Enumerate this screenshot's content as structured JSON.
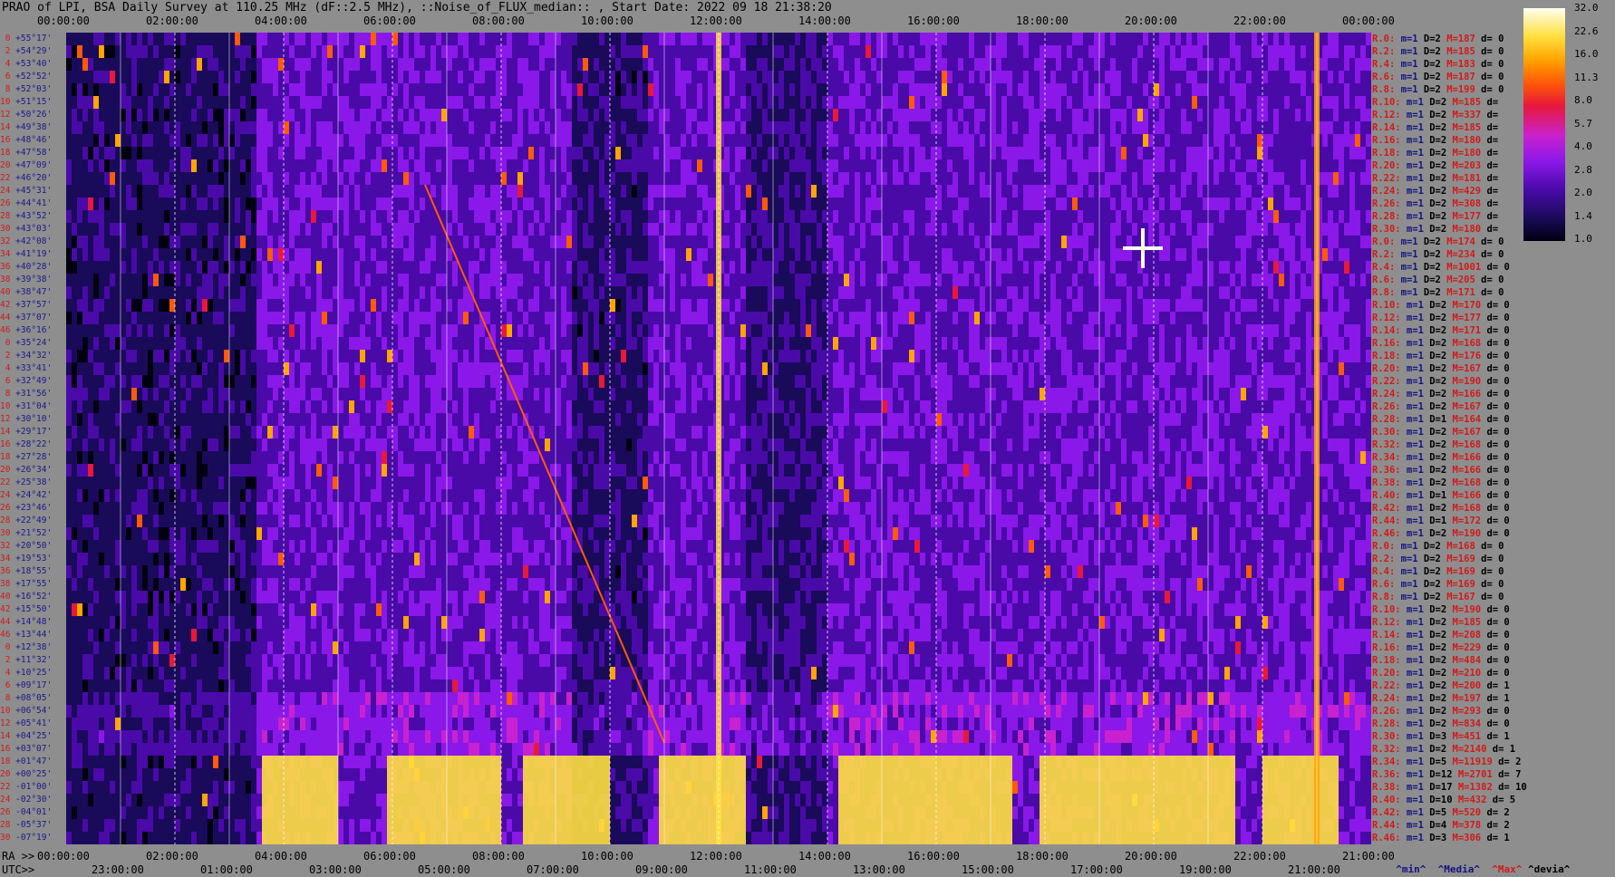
{
  "title": "PRAO of LPI, BSA Daily Survey at 110.25 MHz (dF::2.5 MHz), ::Noise_of_FLUX_median:: , Start Date: 2022 09 18 21:38:20",
  "top_axis_labels": [
    "00:00:00",
    "02:00:00",
    "04:00:00",
    "06:00:00",
    "08:00:00",
    "10:00:00",
    "12:00:00",
    "14:00:00",
    "16:00:00",
    "18:00:00",
    "20:00:00",
    "22:00:00",
    "00:00:00"
  ],
  "ra_prefix": "RA >>",
  "bottom_ra_labels": [
    "00:00:00",
    "02:00:00",
    "04:00:00",
    "06:00:00",
    "08:00:00",
    "10:00:00",
    "12:00:00",
    "14:00:00",
    "16:00:00",
    "18:00:00",
    "20:00:00",
    "22:00:00",
    "21:00:00"
  ],
  "utc_prefix": "UTC>>",
  "bottom_utc_labels": [
    "23:00:00",
    "01:00:00",
    "03:00:00",
    "05:00:00",
    "07:00:00",
    "09:00:00",
    "11:00:00",
    "13:00:00",
    "15:00:00",
    "17:00:00",
    "19:00:00",
    "21:00:00"
  ],
  "colorbar_labels": [
    "32.0",
    "22.6",
    "16.0",
    "11.3",
    "8.0",
    "5.7",
    "4.0",
    "2.8",
    "2.0",
    "1.4",
    "1.0"
  ],
  "legend": {
    "min": "^min^",
    "median": "^Media^",
    "max": "^Max^",
    "devia": "^devia^"
  },
  "declinations": [
    {
      "i": "0",
      "d": "+55°17'"
    },
    {
      "i": "2",
      "d": "+54°29'"
    },
    {
      "i": "4",
      "d": "+53°40'"
    },
    {
      "i": "6",
      "d": "+52°52'"
    },
    {
      "i": "8",
      "d": "+52°03'"
    },
    {
      "i": "10",
      "d": "+51°15'"
    },
    {
      "i": "12",
      "d": "+50°26'"
    },
    {
      "i": "14",
      "d": "+49°38'"
    },
    {
      "i": "16",
      "d": "+48°46'"
    },
    {
      "i": "18",
      "d": "+47°58'"
    },
    {
      "i": "20",
      "d": "+47°09'"
    },
    {
      "i": "22",
      "d": "+46°20'"
    },
    {
      "i": "24",
      "d": "+45°31'"
    },
    {
      "i": "26",
      "d": "+44°41'"
    },
    {
      "i": "28",
      "d": "+43°52'"
    },
    {
      "i": "30",
      "d": "+43°03'"
    },
    {
      "i": "32",
      "d": "+42°08'"
    },
    {
      "i": "34",
      "d": "+41°19'"
    },
    {
      "i": "36",
      "d": "+40°28'"
    },
    {
      "i": "38",
      "d": "+39°38'"
    },
    {
      "i": "40",
      "d": "+38°47'"
    },
    {
      "i": "42",
      "d": "+37°57'"
    },
    {
      "i": "44",
      "d": "+37°07'"
    },
    {
      "i": "46",
      "d": "+36°16'"
    },
    {
      "i": "0",
      "d": "+35°24'"
    },
    {
      "i": "2",
      "d": "+34°32'"
    },
    {
      "i": "4",
      "d": "+33°41'"
    },
    {
      "i": "6",
      "d": "+32°49'"
    },
    {
      "i": "8",
      "d": "+31°56'"
    },
    {
      "i": "10",
      "d": "+31°04'"
    },
    {
      "i": "12",
      "d": "+30°10'"
    },
    {
      "i": "14",
      "d": "+29°17'"
    },
    {
      "i": "16",
      "d": "+28°22'"
    },
    {
      "i": "18",
      "d": "+27°28'"
    },
    {
      "i": "20",
      "d": "+26°34'"
    },
    {
      "i": "22",
      "d": "+25°38'"
    },
    {
      "i": "24",
      "d": "+24°42'"
    },
    {
      "i": "26",
      "d": "+23°46'"
    },
    {
      "i": "28",
      "d": "+22°49'"
    },
    {
      "i": "30",
      "d": "+21°52'"
    },
    {
      "i": "32",
      "d": "+20°50'"
    },
    {
      "i": "34",
      "d": "+19°53'"
    },
    {
      "i": "36",
      "d": "+18°55'"
    },
    {
      "i": "38",
      "d": "+17°55'"
    },
    {
      "i": "40",
      "d": "+16°52'"
    },
    {
      "i": "42",
      "d": "+15°50'"
    },
    {
      "i": "44",
      "d": "+14°48'"
    },
    {
      "i": "46",
      "d": "+13°44'"
    },
    {
      "i": "0",
      "d": "+12°38'"
    },
    {
      "i": "2",
      "d": "+11°32'"
    },
    {
      "i": "4",
      "d": "+10°25'"
    },
    {
      "i": "6",
      "d": "+09°17'"
    },
    {
      "i": "8",
      "d": "+08°05'"
    },
    {
      "i": "10",
      "d": "+06°54'"
    },
    {
      "i": "12",
      "d": "+05°41'"
    },
    {
      "i": "14",
      "d": "+04°25'"
    },
    {
      "i": "16",
      "d": "+03°07'"
    },
    {
      "i": "18",
      "d": "+01°47'"
    },
    {
      "i": "20",
      "d": "+00°25'"
    },
    {
      "i": "22",
      "d": "-01°00'"
    },
    {
      "i": "24",
      "d": "-02°30'"
    },
    {
      "i": "26",
      "d": "-04°01'"
    },
    {
      "i": "28",
      "d": "-05°37'"
    },
    {
      "i": "30",
      "d": "-07°19'"
    }
  ],
  "stats": [
    {
      "r": "R.0:",
      "m": "m=1",
      "D": "D=2",
      "M": "M=187",
      "dv": "d= 0"
    },
    {
      "r": "R.2:",
      "m": "m=1",
      "D": "D=2",
      "M": "M=185",
      "dv": "d= 0"
    },
    {
      "r": "R.4:",
      "m": "m=1",
      "D": "D=2",
      "M": "M=183",
      "dv": "d= 0"
    },
    {
      "r": "R.6:",
      "m": "m=1",
      "D": "D=2",
      "M": "M=187",
      "dv": "d= 0"
    },
    {
      "r": "R.8:",
      "m": "m=1",
      "D": "D=2",
      "M": "M=199",
      "dv": "d= 0"
    },
    {
      "r": "R.10:",
      "m": "m=1",
      "D": "D=2",
      "M": "M=185",
      "dv": "d="
    },
    {
      "r": "R.12:",
      "m": "m=1",
      "D": "D=2",
      "M": "M=337",
      "dv": "d="
    },
    {
      "r": "R.14:",
      "m": "m=1",
      "D": "D=2",
      "M": "M=185",
      "dv": "d="
    },
    {
      "r": "R.16:",
      "m": "m=1",
      "D": "D=2",
      "M": "M=180",
      "dv": "d="
    },
    {
      "r": "R.18:",
      "m": "m=1",
      "D": "D=2",
      "M": "M=180",
      "dv": "d="
    },
    {
      "r": "R.20:",
      "m": "m=1",
      "D": "D=2",
      "M": "M=203",
      "dv": "d="
    },
    {
      "r": "R.22:",
      "m": "m=1",
      "D": "D=2",
      "M": "M=181",
      "dv": "d="
    },
    {
      "r": "R.24:",
      "m": "m=1",
      "D": "D=2",
      "M": "M=429",
      "dv": "d="
    },
    {
      "r": "R.26:",
      "m": "m=1",
      "D": "D=2",
      "M": "M=308",
      "dv": "d="
    },
    {
      "r": "R.28:",
      "m": "m=1",
      "D": "D=2",
      "M": "M=177",
      "dv": "d="
    },
    {
      "r": "R.30:",
      "m": "m=1",
      "D": "D=2",
      "M": "M=180",
      "dv": "d="
    },
    {
      "r": "R.0:",
      "m": "m=1",
      "D": "D=2",
      "M": "M=174",
      "dv": "d= 0"
    },
    {
      "r": "R.2:",
      "m": "m=1",
      "D": "D=2",
      "M": "M=234",
      "dv": "d= 0"
    },
    {
      "r": "R.4:",
      "m": "m=1",
      "D": "D=2",
      "M": "M=1001",
      "dv": "d= 0"
    },
    {
      "r": "R.6:",
      "m": "m=1",
      "D": "D=2",
      "M": "M=205",
      "dv": "d= 0"
    },
    {
      "r": "R.8:",
      "m": "m=1",
      "D": "D=2",
      "M": "M=171",
      "dv": "d= 0"
    },
    {
      "r": "R.10:",
      "m": "m=1",
      "D": "D=2",
      "M": "M=170",
      "dv": "d= 0"
    },
    {
      "r": "R.12:",
      "m": "m=1",
      "D": "D=2",
      "M": "M=177",
      "dv": "d= 0"
    },
    {
      "r": "R.14:",
      "m": "m=1",
      "D": "D=2",
      "M": "M=171",
      "dv": "d= 0"
    },
    {
      "r": "R.16:",
      "m": "m=1",
      "D": "D=2",
      "M": "M=168",
      "dv": "d= 0"
    },
    {
      "r": "R.18:",
      "m": "m=1",
      "D": "D=2",
      "M": "M=176",
      "dv": "d= 0"
    },
    {
      "r": "R.20:",
      "m": "m=1",
      "D": "D=2",
      "M": "M=167",
      "dv": "d= 0"
    },
    {
      "r": "R.22:",
      "m": "m=1",
      "D": "D=2",
      "M": "M=190",
      "dv": "d= 0"
    },
    {
      "r": "R.24:",
      "m": "m=1",
      "D": "D=2",
      "M": "M=166",
      "dv": "d= 0"
    },
    {
      "r": "R.26:",
      "m": "m=1",
      "D": "D=2",
      "M": "M=167",
      "dv": "d= 0"
    },
    {
      "r": "R.28:",
      "m": "m=1",
      "D": "D=1",
      "M": "M=164",
      "dv": "d= 0"
    },
    {
      "r": "R.30:",
      "m": "m=1",
      "D": "D=2",
      "M": "M=167",
      "dv": "d= 0"
    },
    {
      "r": "R.32:",
      "m": "m=1",
      "D": "D=2",
      "M": "M=168",
      "dv": "d= 0"
    },
    {
      "r": "R.34:",
      "m": "m=1",
      "D": "D=2",
      "M": "M=166",
      "dv": "d= 0"
    },
    {
      "r": "R.36:",
      "m": "m=1",
      "D": "D=2",
      "M": "M=166",
      "dv": "d= 0"
    },
    {
      "r": "R.38:",
      "m": "m=1",
      "D": "D=2",
      "M": "M=168",
      "dv": "d= 0"
    },
    {
      "r": "R.40:",
      "m": "m=1",
      "D": "D=1",
      "M": "M=166",
      "dv": "d= 0"
    },
    {
      "r": "R.42:",
      "m": "m=1",
      "D": "D=2",
      "M": "M=168",
      "dv": "d= 0"
    },
    {
      "r": "R.44:",
      "m": "m=1",
      "D": "D=1",
      "M": "M=172",
      "dv": "d= 0"
    },
    {
      "r": "R.46:",
      "m": "m=1",
      "D": "D=2",
      "M": "M=190",
      "dv": "d= 0"
    },
    {
      "r": "R.0:",
      "m": "m=1",
      "D": "D=2",
      "M": "M=168",
      "dv": "d= 0"
    },
    {
      "r": "R.2:",
      "m": "m=1",
      "D": "D=2",
      "M": "M=169",
      "dv": "d= 0"
    },
    {
      "r": "R.4:",
      "m": "m=1",
      "D": "D=2",
      "M": "M=169",
      "dv": "d= 0"
    },
    {
      "r": "R.6:",
      "m": "m=1",
      "D": "D=2",
      "M": "M=169",
      "dv": "d= 0"
    },
    {
      "r": "R.8:",
      "m": "m=1",
      "D": "D=2",
      "M": "M=167",
      "dv": "d= 0"
    },
    {
      "r": "R.10:",
      "m": "m=1",
      "D": "D=2",
      "M": "M=190",
      "dv": "d= 0"
    },
    {
      "r": "R.12:",
      "m": "m=1",
      "D": "D=2",
      "M": "M=185",
      "dv": "d= 0"
    },
    {
      "r": "R.14:",
      "m": "m=1",
      "D": "D=2",
      "M": "M=208",
      "dv": "d= 0"
    },
    {
      "r": "R.16:",
      "m": "m=1",
      "D": "D=2",
      "M": "M=229",
      "dv": "d= 0"
    },
    {
      "r": "R.18:",
      "m": "m=1",
      "D": "D=2",
      "M": "M=484",
      "dv": "d= 0"
    },
    {
      "r": "R.20:",
      "m": "m=1",
      "D": "D=2",
      "M": "M=210",
      "dv": "d= 0"
    },
    {
      "r": "R.22:",
      "m": "m=1",
      "D": "D=2",
      "M": "M=200",
      "dv": "d= 1"
    },
    {
      "r": "R.24:",
      "m": "m=1",
      "D": "D=2",
      "M": "M=197",
      "dv": "d= 1"
    },
    {
      "r": "R.26:",
      "m": "m=1",
      "D": "D=2",
      "M": "M=293",
      "dv": "d= 0"
    },
    {
      "r": "R.28:",
      "m": "m=1",
      "D": "D=2",
      "M": "M=834",
      "dv": "d= 0"
    },
    {
      "r": "R.30:",
      "m": "m=1",
      "D": "D=3",
      "M": "M=451",
      "dv": "d= 1"
    },
    {
      "r": "R.32:",
      "m": "m=1",
      "D": "D=2",
      "M": "M=2140",
      "dv": "d= 1"
    },
    {
      "r": "R.34:",
      "m": "m=1",
      "D": "D=5",
      "M": "M=11919",
      "dv": "d= 2"
    },
    {
      "r": "R.36:",
      "m": "m=1",
      "D": "D=12",
      "M": "M=2701",
      "dv": "d= 7"
    },
    {
      "r": "R.38:",
      "m": "m=1",
      "D": "D=17",
      "M": "M=1382",
      "dv": "d= 10"
    },
    {
      "r": "R.40:",
      "m": "m=1",
      "D": "D=10",
      "M": "M=432",
      "dv": "d= 5"
    },
    {
      "r": "R.42:",
      "m": "m=1",
      "D": "D=5",
      "M": "M=520",
      "dv": "d= 2"
    },
    {
      "r": "R.44:",
      "m": "m=1",
      "D": "D=4",
      "M": "M=378",
      "dv": "d= 2"
    },
    {
      "r": "R.46:",
      "m": "m=1",
      "D": "D=3",
      "M": "M=306",
      "dv": "d= 1"
    }
  ],
  "chart_data": {
    "type": "heatmap",
    "title": "PRAO of LPI, BSA Daily Survey at 110.25 MHz (dF::2.5 MHz), ::Noise_of_FLUX_median:: , Start Date: 2022 09 18 21:38:20",
    "x_axis_top": "RA 00:00:00 – 00:00:00 (24 h)",
    "colorbar": {
      "min": 1.0,
      "max": 32.0,
      "scale": "log2",
      "ticks": [
        32.0,
        22.6,
        16.0,
        11.3,
        8.0,
        5.7,
        4.0,
        2.8,
        2.0,
        1.4,
        1.0
      ],
      "colors": [
        "#000010",
        "#1a0a5a",
        "#4a0aa8",
        "#8a18e8",
        "#c822d0",
        "#e8183a",
        "#ff5a08",
        "#ffa500",
        "#ffe040",
        "#fffff0"
      ]
    },
    "rows": 64,
    "ra_hours_range": [
      0,
      24
    ],
    "features": [
      {
        "name": "strong band",
        "dec_rows": [
          57,
          63
        ],
        "ra_segments": [
          [
            3.6,
            5.0
          ],
          [
            5.9,
            8.0
          ],
          [
            8.4,
            10.0
          ],
          [
            10.9,
            12.5
          ],
          [
            14.2,
            17.4
          ],
          [
            17.9,
            21.5
          ],
          [
            22.0,
            23.4
          ]
        ],
        "level": 24
      },
      {
        "name": "bright column",
        "ra_hours": 12.0,
        "level": 20
      },
      {
        "name": "bright column",
        "ra_hours": 23.0,
        "level": 14
      },
      {
        "name": "drift track",
        "ra_from": 6.6,
        "ra_to": 11.0,
        "dec_row_from": 12,
        "dec_row_to": 56,
        "level": 12
      },
      {
        "name": "bright source",
        "ra_hours": 19.8,
        "dec_row": 17,
        "level": 32
      }
    ]
  }
}
